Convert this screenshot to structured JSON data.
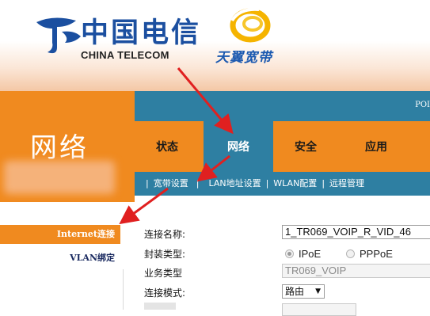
{
  "branding": {
    "telecom_chinese": "中国电信",
    "telecom_english": "CHINA TELECOM",
    "tianyi": "天翼宽带"
  },
  "left_panel": {
    "title": "网络",
    "menu": [
      {
        "label": "Internet连接",
        "active": true
      },
      {
        "label": "VLAN绑定",
        "active": false
      }
    ]
  },
  "nav": {
    "top_strip_text": "POI",
    "tabs": [
      {
        "label": "状态",
        "active": false
      },
      {
        "label": "网络",
        "active": true
      },
      {
        "label": "安全",
        "active": false
      },
      {
        "label": "应用",
        "active": false
      }
    ],
    "subnav": [
      "宽带设置",
      "LAN地址设置",
      "WLAN配置",
      "远程管理"
    ]
  },
  "form": {
    "connection_name_label": "连接名称:",
    "connection_name_value": "1_TR069_VOIP_R_VID_46",
    "encap_label": "封装类型:",
    "encap_options": [
      {
        "label": "IPoE",
        "selected": true
      },
      {
        "label": "PPPoE",
        "selected": false
      }
    ],
    "service_label": "业务类型",
    "service_value": "TR069_VOIP",
    "mode_label": "连接模式:",
    "mode_value": "路由"
  },
  "colors": {
    "orange": "#f08a1f",
    "teal": "#2e7fa2",
    "arrow_red": "#e02020"
  }
}
